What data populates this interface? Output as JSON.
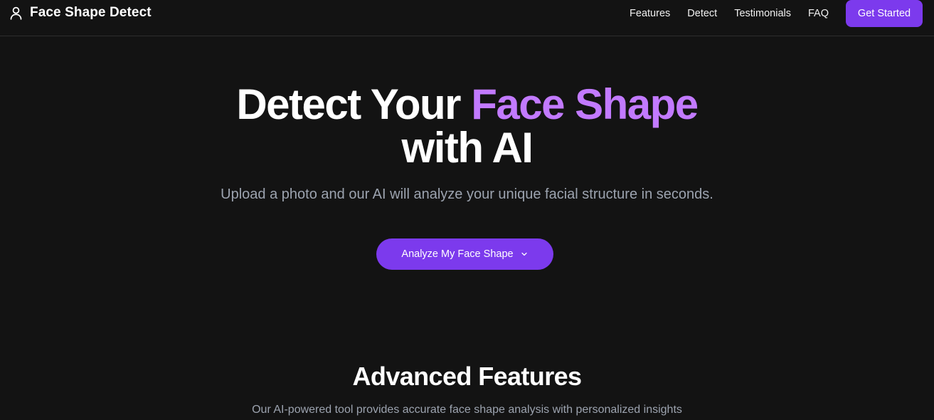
{
  "header": {
    "brand": "Face Shape Detect",
    "brand_icon": "user-icon",
    "nav": [
      {
        "label": "Features"
      },
      {
        "label": "Detect"
      },
      {
        "label": "Testimonials"
      },
      {
        "label": "FAQ"
      }
    ],
    "cta_label": "Get Started"
  },
  "hero": {
    "title_part1": "Detect Your ",
    "title_highlight": "Face Shape",
    "title_line2": "with AI",
    "subtitle": "Upload a photo and our AI will analyze your unique facial structure in seconds.",
    "button_label": "Analyze My Face Shape",
    "button_icon": "chevron-down-icon"
  },
  "features": {
    "title": "Advanced Features",
    "subtitle": "Our AI-powered tool provides accurate face shape analysis with personalized insights"
  },
  "colors": {
    "background": "#131313",
    "accent": "#7c3aed",
    "highlight": "#c27aff",
    "muted_text": "#9ca3af"
  }
}
